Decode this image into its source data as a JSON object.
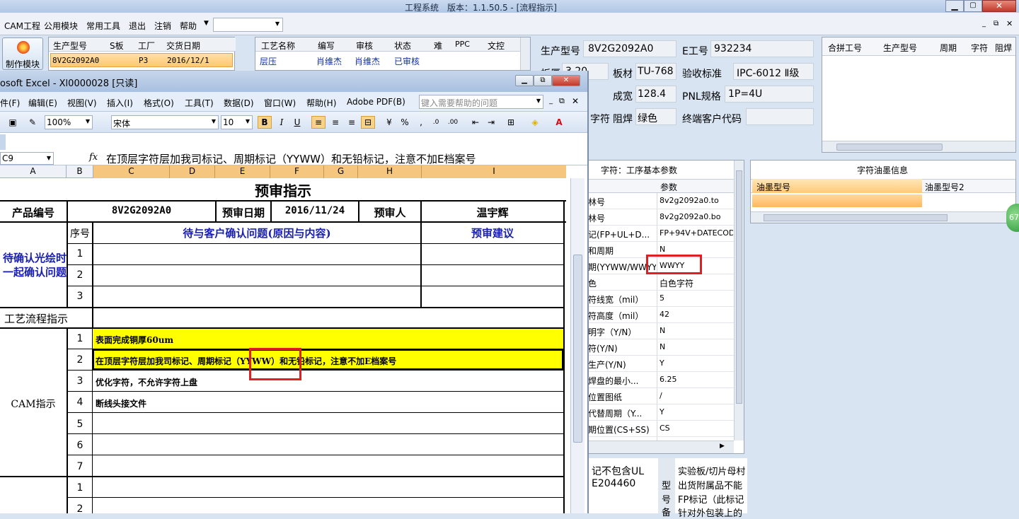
{
  "app": {
    "title": "工程系统　版本：1.1.50.5 - [流程指示]",
    "menu": [
      "CAM工程",
      "公用模块",
      "常用工具",
      "退出",
      "注销",
      "帮助"
    ],
    "make_module_label": "制作模块"
  },
  "order_table": {
    "headers": [
      "生产型号",
      "S板",
      "工厂",
      "交货日期"
    ],
    "row": [
      "8V2G2092A0",
      "",
      "P3",
      "2016/12/1"
    ]
  },
  "process_table": {
    "headers": [
      "工艺名称",
      "编写",
      "审核",
      "状态",
      "难",
      "PPC",
      "文控"
    ],
    "row": [
      "层压",
      "肖维杰",
      "肖维杰",
      "已审核",
      "",
      "",
      ""
    ]
  },
  "info_form": {
    "model_label": "生产型号",
    "model_value": "8V2G2092A0",
    "e_label": "E工号",
    "e_value": "932234",
    "thickness_label": "板厚",
    "thickness_value": "3.20",
    "material_label": "板材",
    "material_value": "TU-768",
    "standard_label": "验收标准",
    "standard_value": "IPC-6012 Ⅱ级",
    "finished_label": "成宽",
    "finished_value": "128.4",
    "pnl_label": "PNL规格",
    "pnl_value": "1P=4U",
    "char_label": "字符",
    "solder_label": "阻焊",
    "solder_value": "绿色",
    "customer_label": "终端客户代码",
    "customer_value": ""
  },
  "merge_table": {
    "headers": [
      "合拼工号",
      "生产型号",
      "周期",
      "字符",
      "阻焊"
    ]
  },
  "param_panel": {
    "title": "字符：工序基本参数",
    "col_param": "参数",
    "rows": [
      {
        "name": "林号",
        "value": "8v2g2092a0.to"
      },
      {
        "name": "林号",
        "value": "8v2g2092a0.bo"
      },
      {
        "name": "记(FP+UL+D...",
        "value": "FP+94V+DATECODE"
      },
      {
        "name": "和周期",
        "value": "N"
      },
      {
        "name": "期(YYWW/WWYY)",
        "value": "WWYY"
      },
      {
        "name": "色",
        "value": "白色字符"
      },
      {
        "name": "符线宽（mil）",
        "value": "5"
      },
      {
        "name": "符高度（mil）",
        "value": "42"
      },
      {
        "name": "明字（Y/N）",
        "value": "N"
      },
      {
        "name": "符(Y/N)",
        "value": "N"
      },
      {
        "name": "生产(Y/N)",
        "value": "Y"
      },
      {
        "name": "焊盘的最小...",
        "value": "6.25"
      },
      {
        "name": "位置图纸",
        "value": "/"
      },
      {
        "name": "代替周期（Y...",
        "value": "Y"
      },
      {
        "name": "期位置(CS+SS)",
        "value": "CS"
      }
    ]
  },
  "ink_panel": {
    "title": "字符油墨信息",
    "headers": [
      "油墨型号",
      "油墨型号2"
    ]
  },
  "bottom_left_text": [
    "记不包含UL",
    "E204460"
  ],
  "bottom_mid_text": [
    "型",
    "号",
    "备"
  ],
  "bottom_right_text": [
    "实验板/切片母村",
    "出货附属品不能",
    "FP标记（此标记",
    "针对外包装上的"
  ],
  "badge": "67",
  "excel": {
    "title": "osoft Excel - Xl0000028 [只读]",
    "menu": [
      "件(F)",
      "编辑(E)",
      "视图(V)",
      "插入(I)",
      "格式(O)",
      "工具(T)",
      "数据(D)",
      "窗口(W)",
      "帮助(H)",
      "Adobe PDF(B)"
    ],
    "help_placeholder": "键入需要帮助的问题",
    "zoom": "100%",
    "font": "宋体",
    "font_size": "10",
    "cell_ref": "C9",
    "formula": "在顶层字符层加我司标记、周期标记（YYWW）和无铅标记，注意不加E档案号",
    "columns": [
      "A",
      "B",
      "C",
      "D",
      "E",
      "F",
      "G",
      "H",
      "I"
    ],
    "sheet": {
      "title": "预审指示",
      "product_label": "产品编号",
      "product_value": "8V2G2092A0",
      "date_label": "预审日期",
      "date_value": "2016/11/24",
      "reviewer_label": "预审人",
      "reviewer_value": "温宇辉",
      "seq_label": "序号",
      "issue_label": "待与客户确认问题(原因与内容)",
      "suggest_label": "预审建议",
      "confirm_label_1": "待确认光绘时",
      "confirm_label_2": "一起确认问题",
      "flow_label": "工艺流程指示",
      "cam_label": "CAM指示",
      "issue_nums": [
        "1",
        "2",
        "3"
      ],
      "cam_nums": [
        "1",
        "2",
        "3",
        "4",
        "5",
        "6",
        "7"
      ],
      "cam_items": [
        "表面完成铜厚60um",
        "在顶层字符层加我司标记、周期标记（YYWW）和无铅标记，注意不加E档案号",
        "优化字符，不允许字符上盘",
        "断线头接文件",
        "",
        "",
        ""
      ],
      "next_nums": [
        "1",
        "2"
      ]
    }
  }
}
